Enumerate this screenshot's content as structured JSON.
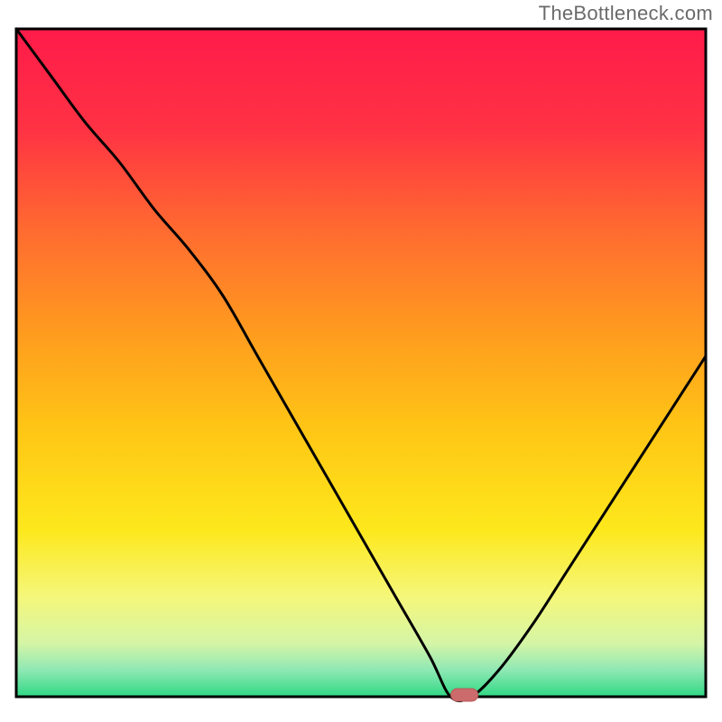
{
  "attribution": "TheBottleneck.com",
  "chart_data": {
    "type": "line",
    "title": "",
    "xlabel": "",
    "ylabel": "",
    "x": [
      0.0,
      0.05,
      0.1,
      0.15,
      0.2,
      0.25,
      0.3,
      0.35,
      0.4,
      0.45,
      0.5,
      0.55,
      0.6,
      0.63,
      0.66,
      0.7,
      0.75,
      0.8,
      0.85,
      0.9,
      0.95,
      1.0
    ],
    "values": [
      1.0,
      0.93,
      0.86,
      0.8,
      0.73,
      0.67,
      0.6,
      0.51,
      0.42,
      0.33,
      0.24,
      0.15,
      0.06,
      0.0,
      0.0,
      0.04,
      0.11,
      0.19,
      0.27,
      0.35,
      0.43,
      0.51
    ],
    "marker": {
      "x": 0.65,
      "y": 0.0
    },
    "xlim": [
      0,
      1
    ],
    "ylim": [
      0,
      1
    ],
    "background": {
      "type": "vertical-gradient",
      "stops": [
        {
          "offset": 0.0,
          "color": "#ff1b4a"
        },
        {
          "offset": 0.15,
          "color": "#ff3244"
        },
        {
          "offset": 0.3,
          "color": "#ff6a30"
        },
        {
          "offset": 0.45,
          "color": "#ff9a1f"
        },
        {
          "offset": 0.6,
          "color": "#ffc615"
        },
        {
          "offset": 0.75,
          "color": "#fde81c"
        },
        {
          "offset": 0.85,
          "color": "#f5f77a"
        },
        {
          "offset": 0.92,
          "color": "#d5f5a6"
        },
        {
          "offset": 0.96,
          "color": "#8fe8b4"
        },
        {
          "offset": 1.0,
          "color": "#2fd884"
        }
      ]
    }
  }
}
